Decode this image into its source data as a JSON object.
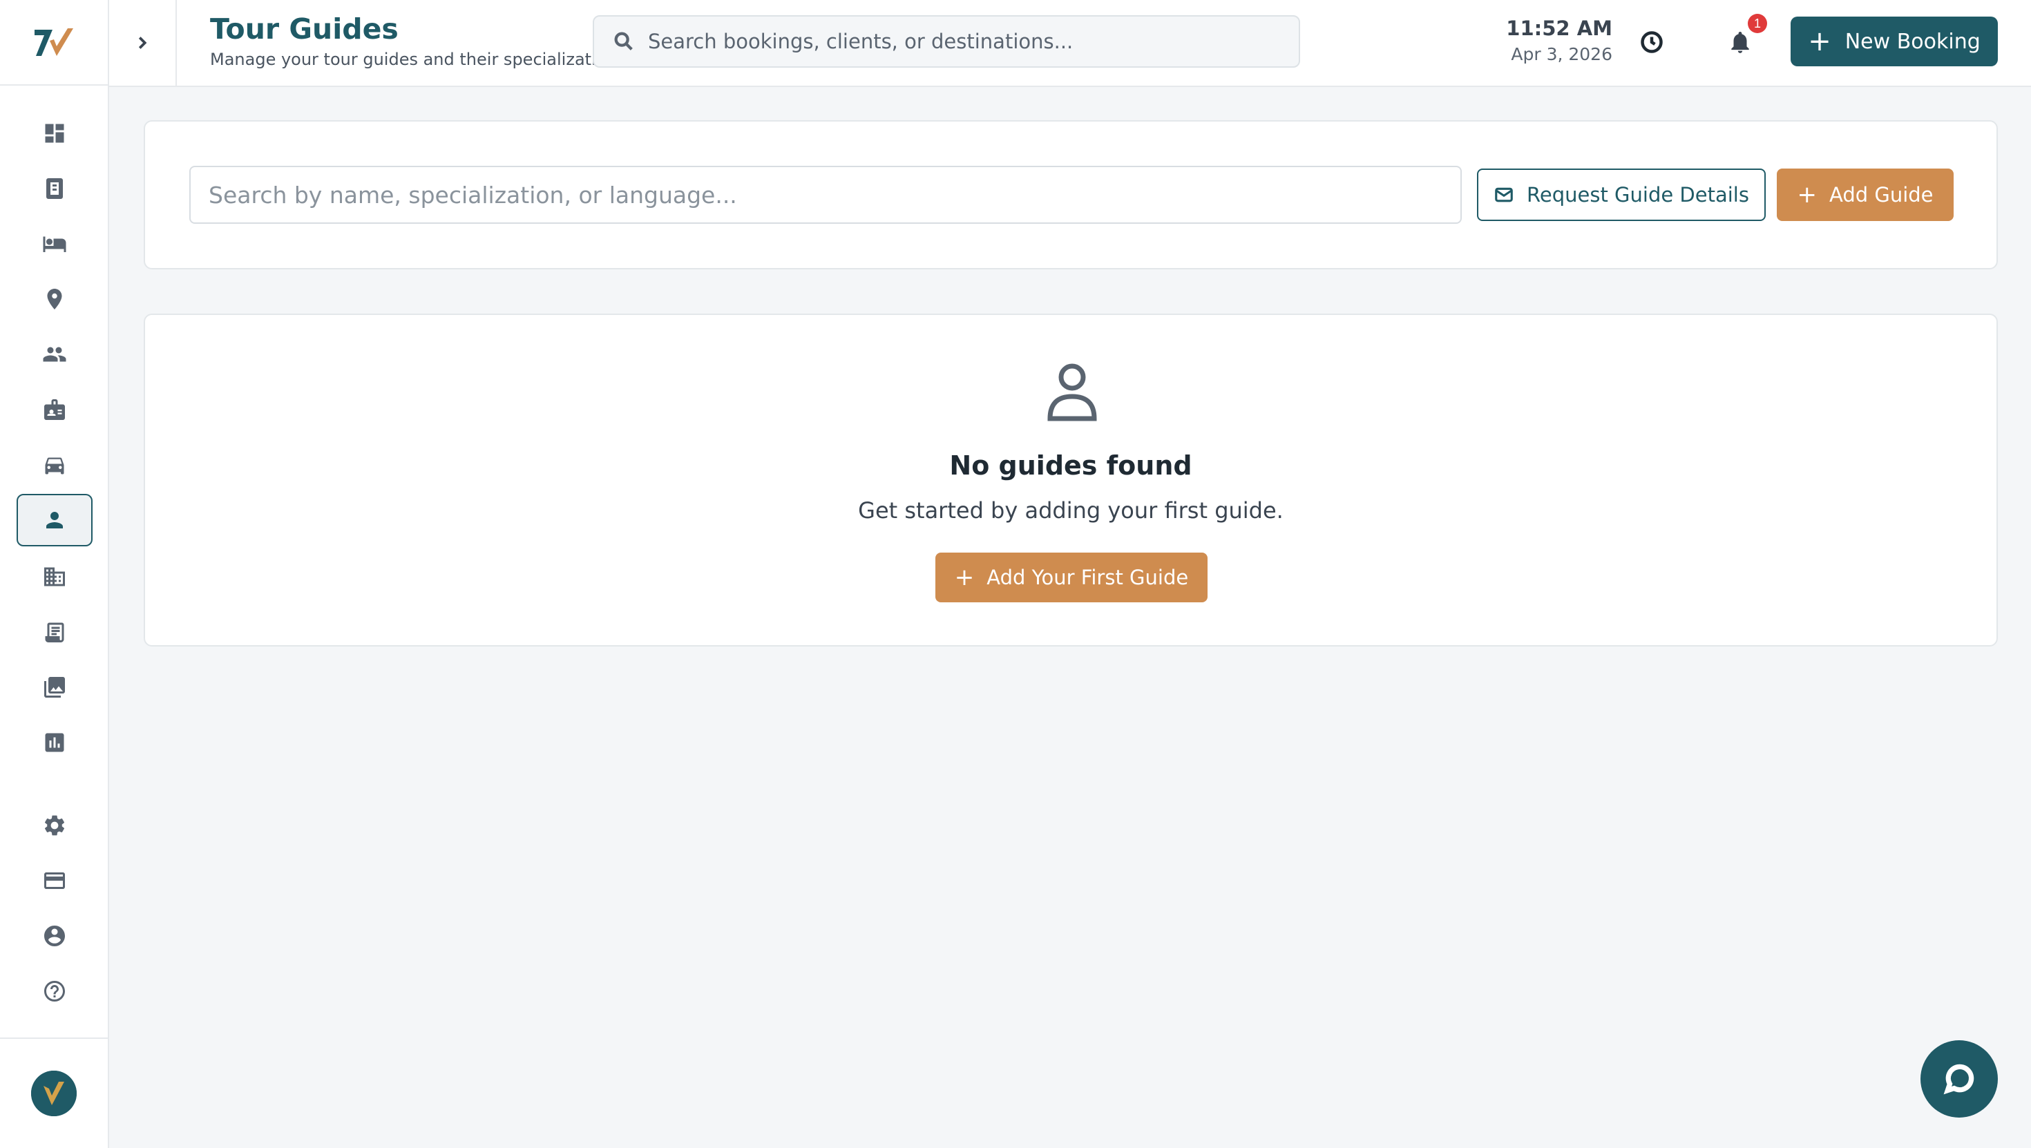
{
  "header": {
    "title": "Tour Guides",
    "subtitle": "Manage your tour guides and their specializations",
    "search_placeholder": "Search bookings, clients, or destinations...",
    "time": "11:52 AM",
    "date": "Apr 3, 2026",
    "notification_count": "1",
    "new_booking_label": "New Booking"
  },
  "sidebar": {
    "items": [
      {
        "icon": "dashboard-icon"
      },
      {
        "icon": "bookings-icon"
      },
      {
        "icon": "hotel-icon"
      },
      {
        "icon": "location-icon"
      },
      {
        "icon": "clients-icon"
      },
      {
        "icon": "staff-badge-icon"
      },
      {
        "icon": "car-icon"
      },
      {
        "icon": "person-icon",
        "active": true
      },
      {
        "icon": "building-icon"
      },
      {
        "icon": "invoice-icon"
      },
      {
        "icon": "gallery-icon"
      },
      {
        "icon": "reports-icon"
      },
      {
        "icon": "settings-icon"
      },
      {
        "icon": "billing-icon"
      },
      {
        "icon": "account-icon"
      },
      {
        "icon": "help-icon"
      }
    ]
  },
  "filters": {
    "search_placeholder": "Search by name, specialization, or language...",
    "request_label": "Request Guide Details",
    "add_label": "Add Guide"
  },
  "empty_state": {
    "title": "No guides found",
    "text": "Get started by adding your first guide.",
    "button_label": "Add Your First Guide"
  },
  "colors": {
    "primary": "#1f5a66",
    "accent": "#cf8c4f",
    "badge": "#e03a3a"
  }
}
